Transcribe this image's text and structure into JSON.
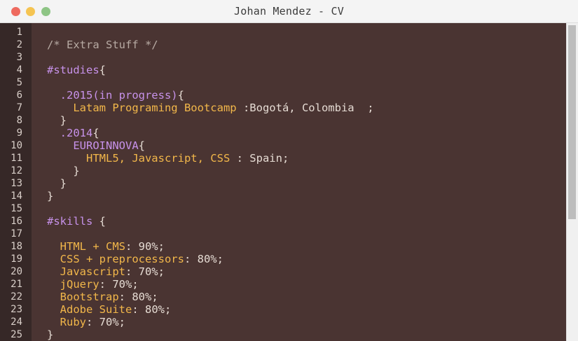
{
  "window": {
    "title": "Johan Mendez - CV",
    "controls": [
      "close",
      "minimize",
      "maximize"
    ]
  },
  "colors": {
    "editor_background": "#4a3432",
    "gutter_background": "#362827",
    "comment": "#b7aaa3",
    "selector": "#c792ea",
    "property": "#f2b74a",
    "text": "#e6dcd4"
  },
  "editor": {
    "line_numbers": [
      "1",
      "2",
      "3",
      "4",
      "5",
      "6",
      "7",
      "8",
      "9",
      "10",
      "11",
      "12",
      "13",
      "14",
      "15",
      "16",
      "17",
      "18",
      "19",
      "20",
      "21",
      "22",
      "23",
      "24",
      "25"
    ],
    "lines": [
      [],
      [
        {
          "t": "/* Extra Stuff */",
          "c": "cm"
        }
      ],
      [],
      [
        {
          "t": "#studies",
          "c": "sel"
        },
        {
          "t": "{",
          "c": "pun"
        }
      ],
      [],
      [
        {
          "t": "  .2015(in progress)",
          "c": "sel"
        },
        {
          "t": "{",
          "c": "pun"
        }
      ],
      [
        {
          "t": "    Latam Programing Bootcamp ",
          "c": "prp"
        },
        {
          "t": ":Bogotá, Colombia  ;",
          "c": "val"
        }
      ],
      [
        {
          "t": "  }",
          "c": "pun"
        }
      ],
      [
        {
          "t": "  .2014",
          "c": "sel"
        },
        {
          "t": "{",
          "c": "pun"
        }
      ],
      [
        {
          "t": "    EUROINNOVA",
          "c": "sel"
        },
        {
          "t": "{",
          "c": "pun"
        }
      ],
      [
        {
          "t": "      HTML5, Javascript, CSS",
          "c": "prp"
        },
        {
          "t": " : Spain;",
          "c": "val"
        }
      ],
      [
        {
          "t": "    }",
          "c": "pun"
        }
      ],
      [
        {
          "t": "  }",
          "c": "pun"
        }
      ],
      [
        {
          "t": "}",
          "c": "pun"
        }
      ],
      [],
      [
        {
          "t": "#skills ",
          "c": "sel"
        },
        {
          "t": "{",
          "c": "pun"
        }
      ],
      [],
      [
        {
          "t": "  HTML + CMS",
          "c": "prp"
        },
        {
          "t": ": 90%;",
          "c": "val"
        }
      ],
      [
        {
          "t": "  CSS + preprocessors",
          "c": "prp"
        },
        {
          "t": ": 80%;",
          "c": "val"
        }
      ],
      [
        {
          "t": "  Javascript",
          "c": "prp"
        },
        {
          "t": ": 70%;",
          "c": "val"
        }
      ],
      [
        {
          "t": "  jQuery",
          "c": "prp"
        },
        {
          "t": ": 70%;",
          "c": "val"
        }
      ],
      [
        {
          "t": "  Bootstrap",
          "c": "prp"
        },
        {
          "t": ": 80%;",
          "c": "val"
        }
      ],
      [
        {
          "t": "  Adobe Suite",
          "c": "prp"
        },
        {
          "t": ": 80%;",
          "c": "val"
        }
      ],
      [
        {
          "t": "  Ruby",
          "c": "prp"
        },
        {
          "t": ": 70%;",
          "c": "val"
        }
      ],
      [
        {
          "t": "}",
          "c": "pun"
        }
      ]
    ]
  },
  "scrollbar": {
    "thumb_fraction": 0.6
  }
}
